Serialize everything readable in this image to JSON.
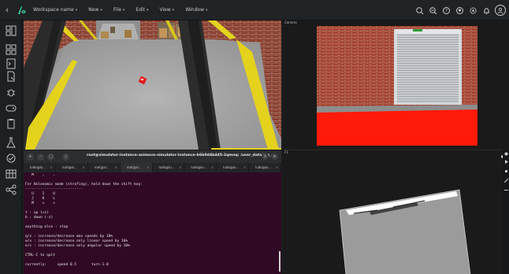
{
  "menu": {
    "items": [
      {
        "label": "Workspace name",
        "has_dropdown": true
      },
      {
        "label": "New",
        "has_dropdown": true
      },
      {
        "label": "File",
        "has_dropdown": true
      },
      {
        "label": "Edit",
        "has_dropdown": true
      },
      {
        "label": "View",
        "has_dropdown": true
      },
      {
        "label": "Window",
        "has_dropdown": true
      }
    ]
  },
  "top_icons": [
    "search-icon",
    "zoom-out-icon",
    "help-icon",
    "github-icon",
    "settings-icon",
    "notifications-icon"
  ],
  "sidebar_icons": [
    "layout-icon",
    "widgets-icon",
    "code-icon",
    "document-icon",
    "bug-icon",
    "gamepad-icon",
    "clipboard-icon",
    "flask-icon",
    "deploy-icon",
    "table-icon",
    "network-icon"
  ],
  "camera": {
    "title": "Camera"
  },
  "terminal": {
    "title": "root@simulator-instance-asimovo-simulator-instance-b6b0d4b445-2qmnq: /user_data/ros_ws",
    "tabs": [
      "ludo@lu...",
      "root@si...",
      "root@si...",
      "root@si...",
      "ludo@lu...",
      "ludo@lu...",
      "ludo@lu...",
      "ludo@lu..."
    ],
    "active_tab": 3,
    "lines": [
      "   M    ,    .",
      "",
      "For Holonomic mode (strafing), hold down the shift key:",
      "---------------------------",
      "   U    I    O",
      "   J    K    L",
      "   M    <    >",
      "",
      "t : up (+z)",
      "b : down (-z)",
      "",
      "anything else : stop",
      "",
      "q/z : increase/decrease max speeds by 10%",
      "w/x : increase/decrease only linear speed by 10%",
      "e/c : increase/decrease only angular speed by 10%",
      "",
      "CTRL-C to quit",
      "",
      "currently:     speed 0.5       turn 1.0"
    ]
  },
  "lowpanel": {
    "title": "F1"
  },
  "colors": {
    "accent": "#3bd6a6",
    "terminal_bg": "#300a24",
    "floor_red": "#ff1a0a",
    "caution_yellow": "#e4d21c"
  }
}
